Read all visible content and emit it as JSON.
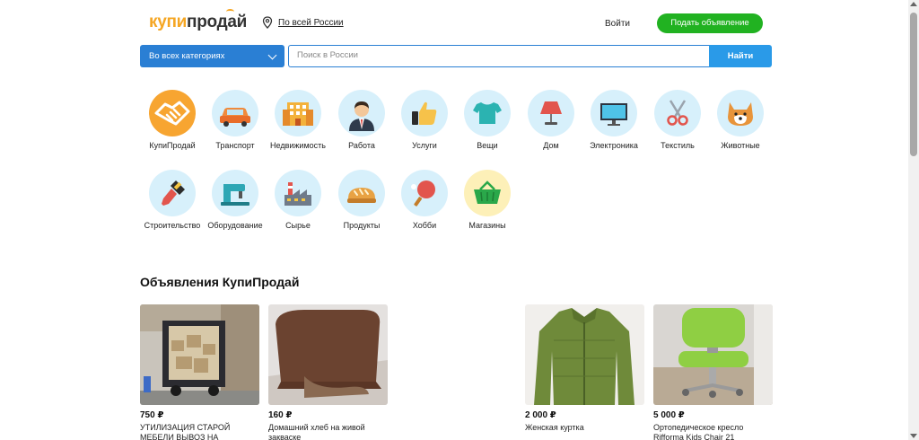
{
  "header": {
    "logo_part1": "купи",
    "logo_part2": "продай",
    "location_label": "По всей России",
    "login_label": "Войти",
    "post_button_label": "Подать объявление"
  },
  "search": {
    "category_select": "Во всех категориях",
    "placeholder": "Поиск в России",
    "button_label": "Найти"
  },
  "categories": [
    {
      "label": "КупиПродай",
      "icon": "handshake-icon"
    },
    {
      "label": "Транспорт",
      "icon": "car-icon"
    },
    {
      "label": "Недвижимость",
      "icon": "building-icon"
    },
    {
      "label": "Работа",
      "icon": "worker-icon"
    },
    {
      "label": "Услуги",
      "icon": "thumbs-up-icon"
    },
    {
      "label": "Вещи",
      "icon": "tshirt-icon"
    },
    {
      "label": "Дом",
      "icon": "lamp-icon"
    },
    {
      "label": "Электроника",
      "icon": "monitor-icon"
    },
    {
      "label": "Текстиль",
      "icon": "scissors-icon"
    },
    {
      "label": "Животные",
      "icon": "dog-icon"
    },
    {
      "label": "Строительство",
      "icon": "paint-brush-icon"
    },
    {
      "label": "Оборудование",
      "icon": "sewing-machine-icon"
    },
    {
      "label": "Сырье",
      "icon": "factory-icon"
    },
    {
      "label": "Продукты",
      "icon": "bread-icon"
    },
    {
      "label": "Хобби",
      "icon": "ping-pong-icon"
    },
    {
      "label": "Магазины",
      "icon": "basket-icon"
    }
  ],
  "ads_section_title": "Объявления КупиПродай",
  "ads": [
    {
      "price": "750 ₽",
      "title": "УТИЛИЗАЦИЯ СТАРОЙ МЕБЕЛИ ВЫВОЗ НА",
      "image": "truck-with-furniture"
    },
    {
      "price": "160 ₽",
      "title": "Домашний хлеб на живой закваске",
      "image": "rye-bread"
    },
    {
      "price": "2 000 ₽",
      "title": "Женская куртка",
      "image": "green-jacket"
    },
    {
      "price": "5 000 ₽",
      "title": "Ортопедическое кресло Rifforma Kids Chair 21",
      "image": "green-kids-chair"
    }
  ],
  "colors": {
    "brand_orange": "#f5a623",
    "primary_blue": "#2a7fd4",
    "button_green": "#21b221",
    "category_circle": "#d7f0fb"
  }
}
